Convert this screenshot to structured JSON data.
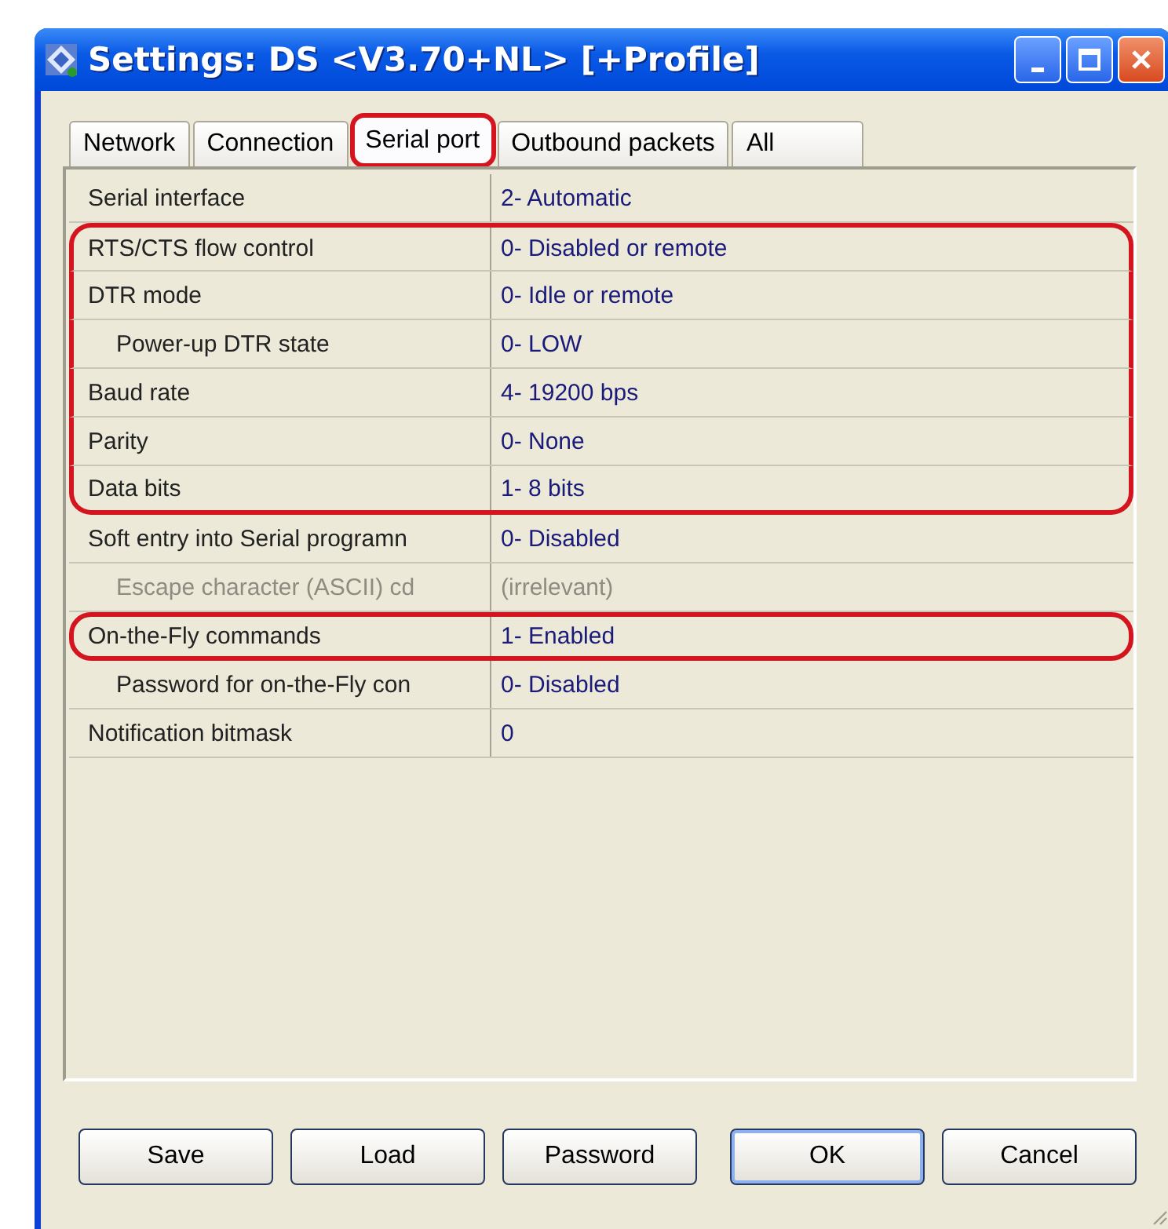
{
  "window": {
    "title": "Settings: DS <V3.70+NL> [+Profile]"
  },
  "tabs": [
    {
      "label": "Network",
      "selected": false,
      "highlighted": false
    },
    {
      "label": "Connection",
      "selected": false,
      "highlighted": false
    },
    {
      "label": "Serial port",
      "selected": true,
      "highlighted": true
    },
    {
      "label": "Outbound packets",
      "selected": false,
      "highlighted": false
    },
    {
      "label": "All",
      "selected": false,
      "highlighted": false
    }
  ],
  "properties": [
    {
      "name": "Serial interface",
      "value": "2- Automatic",
      "disabled": false,
      "highlighted": false
    },
    {
      "name": "RTS/CTS flow control",
      "value": "0- Disabled or remote",
      "disabled": false,
      "highlighted": true
    },
    {
      "name": "DTR mode",
      "value": "0- Idle or remote",
      "disabled": false,
      "highlighted": true,
      "children": [
        {
          "name": "Power-up DTR state",
          "value": "0- LOW",
          "disabled": false,
          "highlighted": true
        }
      ]
    },
    {
      "name": "Baud rate",
      "value": "4- 19200 bps",
      "disabled": false,
      "highlighted": true
    },
    {
      "name": "Parity",
      "value": "0- None",
      "disabled": false,
      "highlighted": true
    },
    {
      "name": "Data bits",
      "value": "1- 8 bits",
      "disabled": false,
      "highlighted": true
    },
    {
      "name": "Soft entry into Serial programn",
      "value": "0- Disabled",
      "disabled": false,
      "highlighted": false,
      "children": [
        {
          "name": "Escape character (ASCII) cd",
          "value": "(irrelevant)",
          "disabled": true,
          "highlighted": false
        }
      ]
    },
    {
      "name": "On-the-Fly commands",
      "value": "1- Enabled",
      "disabled": false,
      "highlighted": true,
      "children": [
        {
          "name": "Password for on-the-Fly con",
          "value": "0- Disabled",
          "disabled": false,
          "highlighted": false
        }
      ]
    },
    {
      "name": "Notification bitmask",
      "value": "0",
      "disabled": false,
      "highlighted": false
    }
  ],
  "buttons": [
    {
      "label": "Save",
      "default": false
    },
    {
      "label": "Load",
      "default": false
    },
    {
      "label": "Password",
      "default": false
    },
    {
      "label": "OK",
      "default": true
    },
    {
      "label": "Cancel",
      "default": false
    }
  ]
}
